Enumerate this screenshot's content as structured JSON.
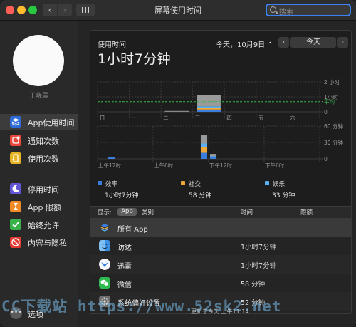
{
  "window": {
    "title": "屏幕使用时间"
  },
  "search": {
    "placeholder": "搜索"
  },
  "user": {
    "name": "王晓晨"
  },
  "sidebar": {
    "items": [
      {
        "label": "App使用时间",
        "icon": "layers-icon",
        "color": "#2f6bd6",
        "selected": true
      },
      {
        "label": "通知次数",
        "icon": "bell-icon",
        "color": "#e8483c"
      },
      {
        "label": "使用次数",
        "icon": "pickup-icon",
        "color": "#e5b324"
      },
      {
        "label": "停用时间",
        "icon": "moon-icon",
        "color": "#6157d6"
      },
      {
        "label": "App 限额",
        "icon": "hourglass-icon",
        "color": "#ef8a26"
      },
      {
        "label": "始终允许",
        "icon": "check-icon",
        "color": "#38b34a"
      },
      {
        "label": "内容与隐私",
        "icon": "no-entry-icon",
        "color": "#e23a32"
      }
    ],
    "options_label": "选项"
  },
  "panel": {
    "title": "使用时间",
    "total": "1小时7分钟",
    "date_label": "今天，10月9日",
    "today_button": "今天"
  },
  "weekly_chart": {
    "days": [
      "日",
      "一",
      "二",
      "三",
      "四",
      "五",
      "六"
    ],
    "y_labels": [
      "2 小时",
      "1小时",
      "0"
    ],
    "average_label": "平均",
    "average_hours": 0.68,
    "ymax_hours": 2,
    "bars": [
      {
        "day": 2,
        "segments": [
          {
            "color": "#888888",
            "hours": 0.06
          }
        ]
      },
      {
        "day": 3,
        "segments": [
          {
            "color": "#3b7ddd",
            "hours": 0.15
          },
          {
            "color": "#f0a73a",
            "hours": 0.13
          },
          {
            "color": "#5ab0f0",
            "hours": 0.09
          },
          {
            "color": "#9a9a9a",
            "hours": 0.75
          }
        ]
      }
    ]
  },
  "daily_chart": {
    "y_labels": [
      "60 分钟",
      "30 分钟",
      "0"
    ],
    "x_labels": [
      "上午12时",
      "上午6时",
      "下午12时",
      "下午6时"
    ],
    "ymax_minutes": 60,
    "bars": [
      {
        "hour": 1,
        "segments": [
          {
            "color": "#3b7ddd",
            "minutes": 3
          }
        ]
      },
      {
        "hour": 11,
        "segments": [
          {
            "color": "#3b7ddd",
            "minutes": 11
          },
          {
            "color": "#f0a73a",
            "minutes": 10
          },
          {
            "color": "#5ab0f0",
            "minutes": 7
          },
          {
            "color": "#9a9a9a",
            "minutes": 15
          }
        ]
      },
      {
        "hour": 12,
        "segments": [
          {
            "color": "#3b7ddd",
            "minutes": 3
          },
          {
            "color": "#5ab0f0",
            "minutes": 2
          },
          {
            "color": "#9a9a9a",
            "minutes": 4
          }
        ]
      }
    ]
  },
  "categories": [
    {
      "name": "效率",
      "time": "1小时7分钟",
      "color": "#3b7ddd"
    },
    {
      "name": "社交",
      "time": "58 分钟",
      "color": "#f0a73a"
    },
    {
      "name": "娱乐",
      "time": "33 分钟",
      "color": "#5ab0f0"
    }
  ],
  "table": {
    "show_label": "显示:",
    "seg_app": "App",
    "seg_category": "类别",
    "col_time": "时间",
    "col_limit": "限额",
    "rows": [
      {
        "name": "所有 App",
        "time": "",
        "icon": "layers-icon",
        "color": "#3a3a3a"
      },
      {
        "name": "访达",
        "time": "1小时7分钟",
        "icon": "finder-icon",
        "color": "#3d8fe3"
      },
      {
        "name": "迅雷",
        "time": "1小时7分钟",
        "icon": "thunder-icon",
        "color": "#2f7fe2"
      },
      {
        "name": "微信",
        "time": "58 分钟",
        "icon": "wechat-icon",
        "color": "#2dbb4f"
      },
      {
        "name": "系统偏好设置",
        "time": "52 分钟",
        "icon": "gear-icon",
        "color": "#8a8a8a"
      }
    ]
  },
  "footer": {
    "updated": "更新于今天 上午11:14"
  },
  "watermark": "CC下载站 https://www.52sk2.net"
}
